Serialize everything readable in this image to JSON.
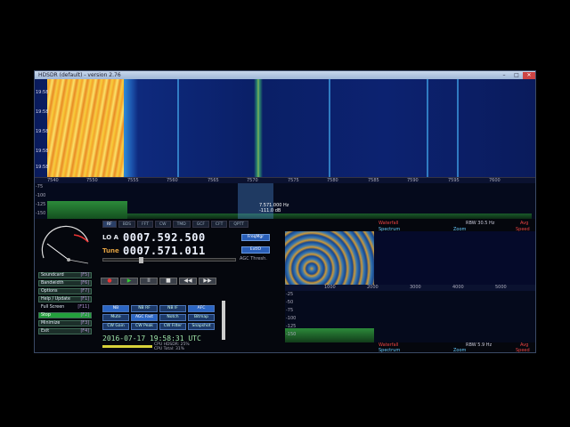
{
  "window": {
    "title": "HDSDR (default) - version 2.76"
  },
  "waterfall": {
    "times": [
      "19:58",
      "19:58",
      "19:58",
      "19:58",
      "19:58"
    ]
  },
  "freq_scale": {
    "ticks": [
      "7540",
      "7550",
      "7555",
      "7560",
      "7565",
      "7570",
      "7575",
      "7580",
      "7585",
      "7590",
      "7595",
      "7600"
    ]
  },
  "spectrum": {
    "ylabels": [
      "-75",
      "-100",
      "-125",
      "-150"
    ],
    "readout_freq": "7.571.000 Hz",
    "readout_db": "-111.0 dB"
  },
  "tabs": [
    "RF",
    "BDS",
    "FFT",
    "CW",
    "TMD",
    "GCF",
    "CFT",
    "QPTT"
  ],
  "lo": {
    "label": "LO A",
    "value": "0007.592.500"
  },
  "tune": {
    "label": "Tune",
    "value": "0007.571.011"
  },
  "side_buttons": {
    "freqmgr": "FreqMgr",
    "extio": "ExtIO"
  },
  "agc": {
    "label": "AGC Thresh."
  },
  "menu": [
    {
      "label": "Soundcard",
      "key": "[F5]"
    },
    {
      "label": "Bandwidth",
      "key": "[F6]"
    },
    {
      "label": "Options",
      "key": "[F7]"
    },
    {
      "label": "Help / Update",
      "key": "[F1]"
    },
    {
      "label": "Full Screen",
      "key": "[F11]"
    },
    {
      "label": "Stop",
      "key": "[F2]"
    },
    {
      "label": "Minimize",
      "key": "[F3]"
    },
    {
      "label": "Exit",
      "key": "[F4]"
    }
  ],
  "transport": [
    "●",
    "▶",
    "II",
    "■",
    "◀◀",
    "▶▶"
  ],
  "modes": [
    "NB",
    "NB RF",
    "NB IF",
    "AFC",
    "Mute",
    "AGC Fast",
    "Notch",
    "Bitmap",
    "CW Gain",
    "CW Peak",
    "CW Filter",
    "Snapshot"
  ],
  "datetime": "2016-07-17   19:58:31 UTC",
  "cpu": {
    "hdsdr": "CPU HDSDR: 25%",
    "total": "CPU Total: 31%"
  },
  "mini": {
    "top_left": "Waterfall",
    "top_right": "Avg",
    "scale": [
      "1000",
      "2000",
      "3000",
      "4000",
      "5000"
    ],
    "ylabels": [
      "-25",
      "-50",
      "-75",
      "-100",
      "-125",
      "-150"
    ],
    "rbw_top": "RBW 30.5 Hz",
    "rbw_bot": "RBW 5.9 Hz",
    "spectrum_lbl": "Spectrum",
    "zoom_lbl": "Zoom",
    "speed_lbl": "Speed"
  }
}
